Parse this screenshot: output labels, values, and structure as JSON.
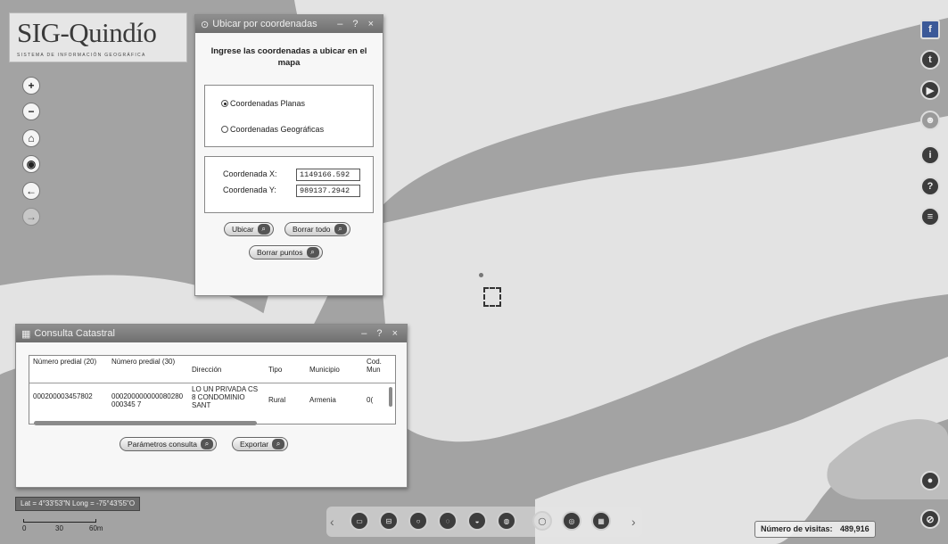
{
  "logo": {
    "title": "SIG-Quindío",
    "subtitle": "SISTEMA DE INFORMACIÓN GEOGRÁFICA"
  },
  "left_toolbar": [
    {
      "name": "zoom-in-icon",
      "glyph": "+",
      "disabled": false
    },
    {
      "name": "zoom-out-icon",
      "glyph": "−",
      "disabled": false
    },
    {
      "name": "home-icon",
      "glyph": "⌂",
      "disabled": false
    },
    {
      "name": "locate-icon",
      "glyph": "◉",
      "disabled": false
    },
    {
      "name": "back-arrow-icon",
      "glyph": "←",
      "disabled": false
    },
    {
      "name": "forward-arrow-icon",
      "glyph": "→",
      "disabled": true
    }
  ],
  "right_toolbar": [
    {
      "name": "facebook-icon",
      "glyph": "f"
    },
    {
      "name": "twitter-icon",
      "glyph": "t"
    },
    {
      "name": "youtube-icon",
      "glyph": "▶"
    },
    {
      "name": "user-icon",
      "glyph": "☻"
    },
    {
      "name": "info-icon",
      "glyph": "i"
    },
    {
      "name": "help-icon",
      "glyph": "?"
    },
    {
      "name": "layers-icon",
      "glyph": "≡"
    }
  ],
  "coords_panel": {
    "title": "Ubicar por coordenadas",
    "controls": "– ? ×",
    "instructions": "Ingrese las coordenadas a ubicar en el mapa",
    "radio_planas": "Coordenadas Planas",
    "radio_geograficas": "Coordenadas Geográficas",
    "label_x": "Coordenada X:",
    "value_x": "1149166.592",
    "label_y": "Coordenada Y:",
    "value_y": "989137.2942",
    "btn_ubicar": "Ubicar",
    "btn_borrar_todo": "Borrar todo",
    "btn_borrar_puntos": "Borrar puntos"
  },
  "catastral_panel": {
    "title": "Consulta Catastral",
    "controls": "– ? ×",
    "headers": [
      "Número predial (20)",
      "Número predial (30)",
      "Dirección",
      "Tipo",
      "Municipio",
      "Cod. Mun"
    ],
    "rows": [
      [
        "000200003457802",
        "000200000000080280000345 7",
        "LO UN PRIVADA CS 8 CONDOMINIO SANT",
        "Rural",
        "Armenia",
        "0("
      ]
    ],
    "btn_parametros": "Parámetros consulta",
    "btn_exportar": "Exportar"
  },
  "latlong": "Lat = 4°33'53\"N Long = -75°43'55\"O",
  "scale_labels": [
    "0",
    "30",
    "60m"
  ],
  "bottom_toolbar": [
    {
      "name": "print-icon",
      "light": false
    },
    {
      "name": "measure-icon",
      "light": false
    },
    {
      "name": "draw-icon",
      "light": false
    },
    {
      "name": "search-icon",
      "light": false
    },
    {
      "name": "layer-icon",
      "light": false
    },
    {
      "name": "coordinates-icon",
      "light": false
    },
    {
      "name": "globe-icon",
      "light": true
    },
    {
      "name": "basemap-icon",
      "light": false
    },
    {
      "name": "table-icon",
      "light": false
    }
  ],
  "visits": {
    "label": "Número de visitas:",
    "value": "489,916"
  },
  "colors": {
    "map_grey": "#a3a3a3",
    "map_light": "#e4e4e4",
    "panel_title": "#7c7c7c"
  }
}
